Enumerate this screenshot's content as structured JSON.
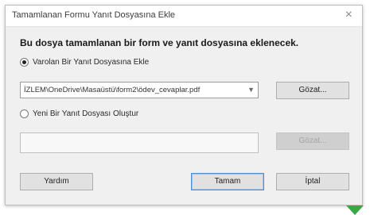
{
  "dialog": {
    "title": "Tamamlanan Formu Yanıt Dosyasına Ekle",
    "close_glyph": "×",
    "heading": "Bu dosya tamamlanan bir form ve yanıt dosyasına eklenecek."
  },
  "options": {
    "existing": {
      "label": "Varolan Bir Yanıt Dosyasına Ekle",
      "selected": true
    },
    "new": {
      "label": "Yeni Bir Yanıt Dosyası Oluştur",
      "selected": false
    }
  },
  "path_field": {
    "value": "İZLEM\\OneDrive\\Masaüstü\\form2\\ödev_cevaplar.pdf",
    "dropdown_icon": "chevron-down-icon"
  },
  "buttons": {
    "browse_existing": "Gözat...",
    "browse_new": "Gözat...",
    "help": "Yardım",
    "ok": "Tamam",
    "cancel": "İptal"
  },
  "colors": {
    "default_button_border": "#4a90d9",
    "corner_marker": "#39a845"
  }
}
